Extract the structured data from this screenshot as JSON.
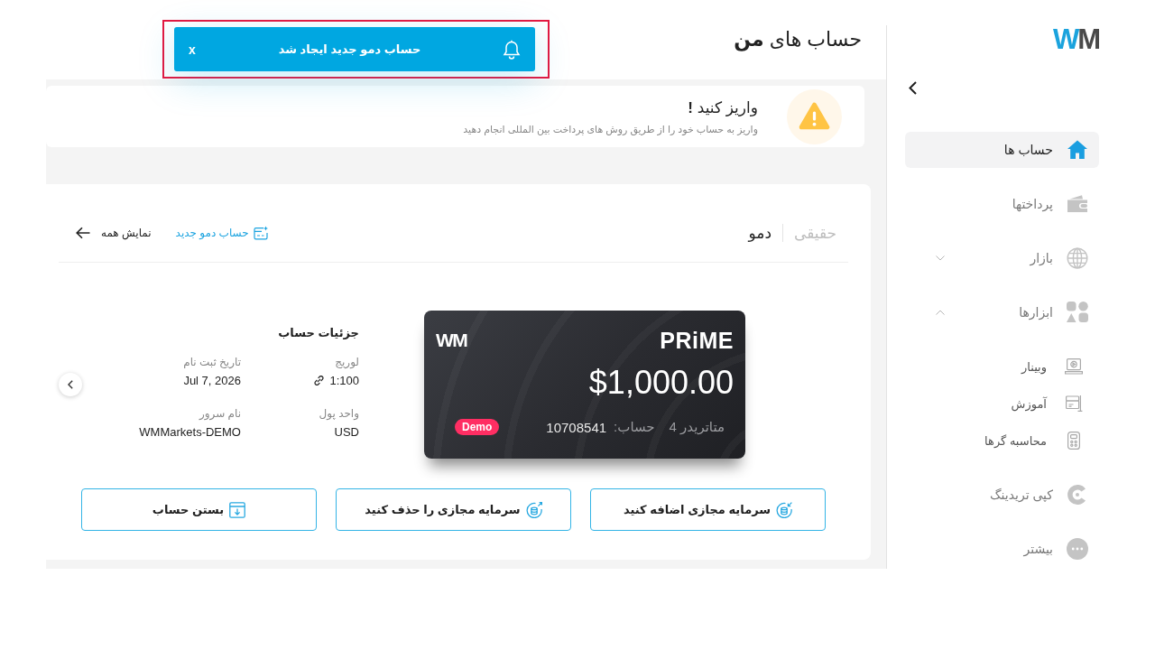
{
  "sidebar": {
    "logo": "WM",
    "items": [
      {
        "label": "حساب ها",
        "kind": "link",
        "selected": true
      },
      {
        "label": "پرداختها",
        "kind": "link",
        "selected": false
      },
      {
        "label": "بازار",
        "kind": "group",
        "selected": false,
        "expanded": false
      },
      {
        "label": "ابزارها",
        "kind": "group",
        "selected": false,
        "expanded": true,
        "children": [
          {
            "label": "وبینار",
            "selected": false
          },
          {
            "label": "آموزش",
            "selected": false
          },
          {
            "label": "محاسبه گرها",
            "selected": false
          }
        ]
      },
      {
        "label": "کپی تریدینگ",
        "kind": "link",
        "selected": false
      },
      {
        "label": "بیشتر",
        "kind": "link",
        "selected": false
      }
    ]
  },
  "header": {
    "title": "حساب های **من**"
  },
  "notification": {
    "message": "حساب دمو جدید ایجاد شد",
    "close": "x",
    "highlighted": true
  },
  "deposit_banner": {
    "title": "واریز کنید **!**",
    "message": "واریز به حساب خود را از طریق روش های پرداخت بین المللی انجام دهید"
  },
  "accounts": {
    "tabs": [
      {
        "label": "حقیقی",
        "selected": false
      },
      {
        "label": "دمو",
        "selected": true
      }
    ],
    "new_demo_link": "حساب دمو جدید",
    "show_all": "نمایش همه",
    "card": {
      "brand": "PRiME",
      "logo": "WM",
      "balance": "$1,000.00",
      "badge": "Demo",
      "platform": "متاتریدر 4",
      "account_label": "حساب:",
      "account_number": "10708541"
    },
    "details": {
      "title": "جزئیات حساب",
      "fields": [
        {
          "label": "لوریج",
          "value": "1:100"
        },
        {
          "label": "تاریخ ثبت نام",
          "value": "Jul 7, 2026"
        },
        {
          "label": "واحد پول",
          "value": "USD"
        },
        {
          "label": "نام سرور",
          "value": "WMMarkets-DEMO"
        }
      ]
    },
    "buttons": [
      "سرمایه مجازی اضافه کنید",
      "سرمایه مجازی را حذف کنید",
      "بستن حساب"
    ]
  }
}
